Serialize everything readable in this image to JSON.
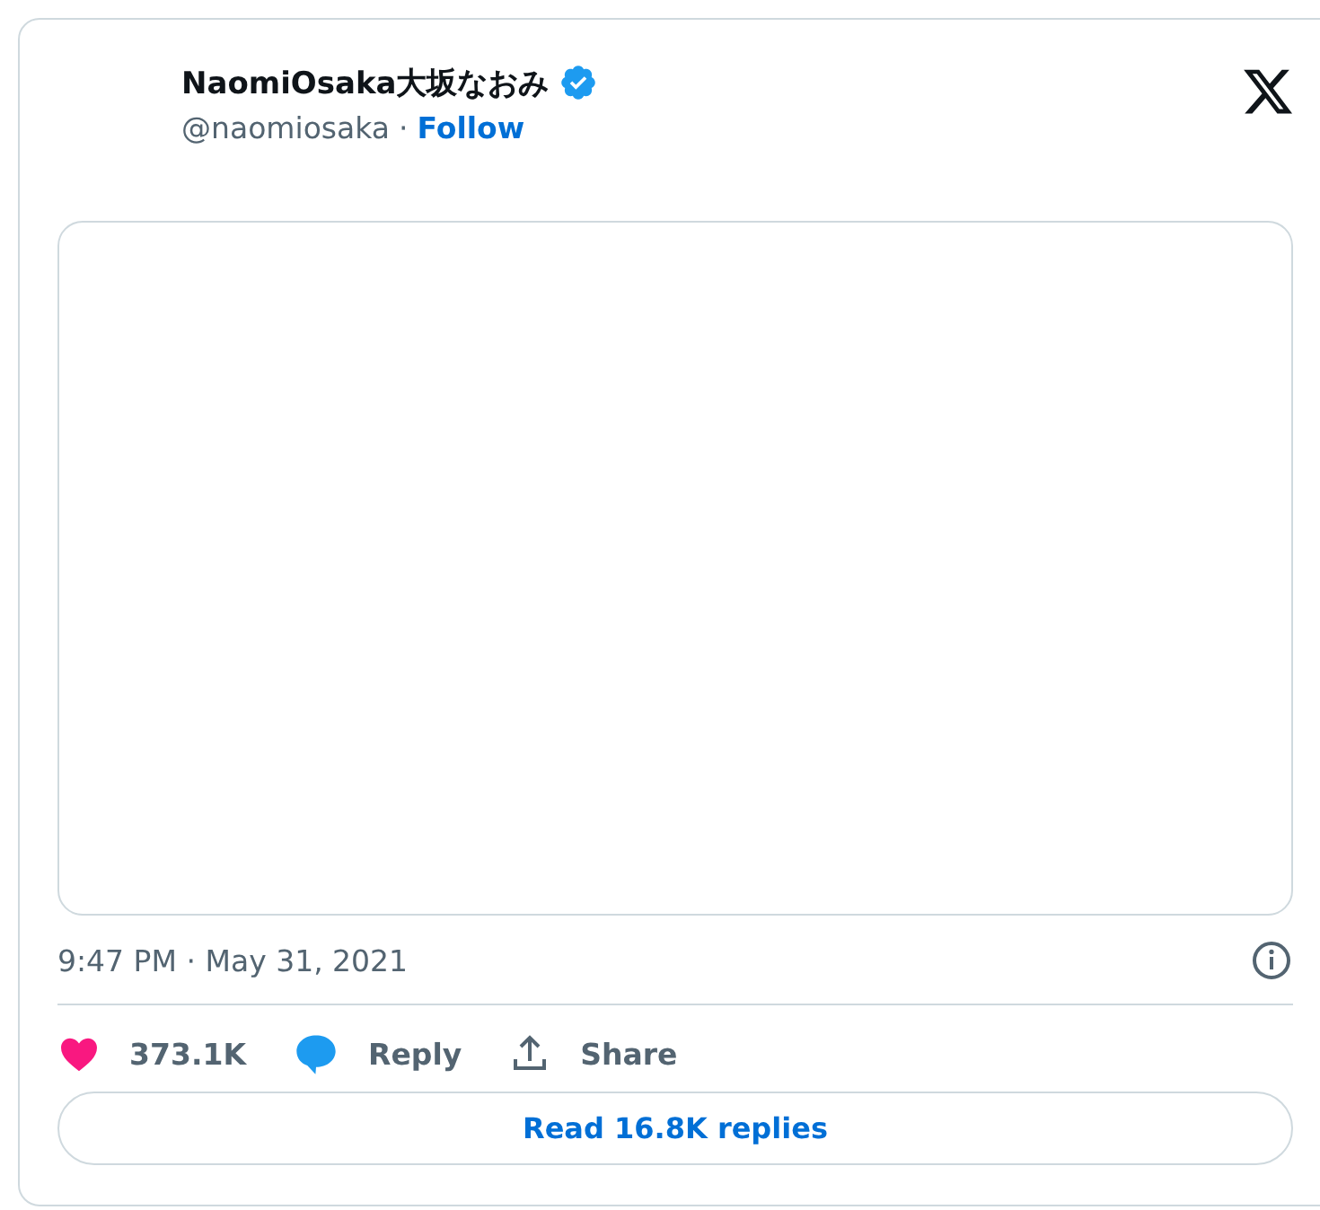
{
  "author": {
    "name": "NaomiOsaka大坂なおみ",
    "verified": true,
    "handle": "@naomiosaka",
    "separator": "·",
    "follow": "Follow"
  },
  "timestamp": "9:47 PM · May 31, 2021",
  "actions": [
    {
      "kind": "like",
      "label": "373.1K"
    },
    {
      "kind": "reply",
      "label": "Reply"
    },
    {
      "kind": "share",
      "label": "Share"
    }
  ],
  "read_replies": "Read 16.8K replies"
}
